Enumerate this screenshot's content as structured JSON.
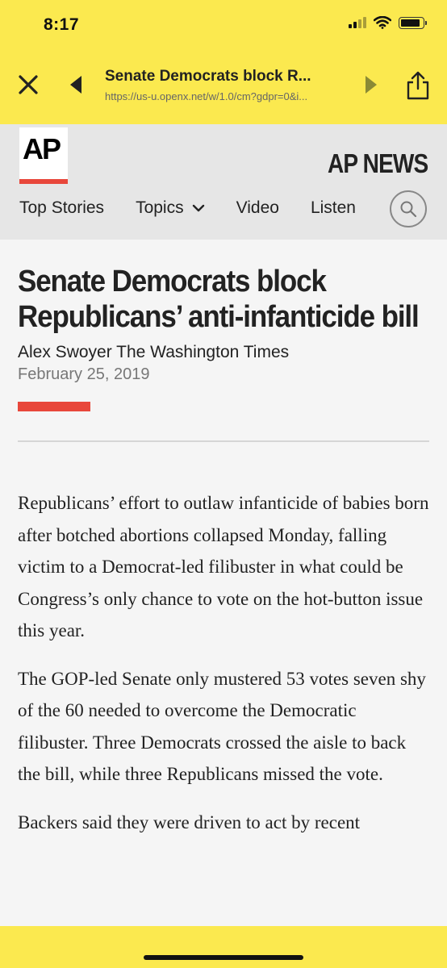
{
  "status": {
    "time": "8:17",
    "battery_level": 0.9
  },
  "browser": {
    "page_title": "Senate Democrats block R...",
    "url": "https://us-u.openx.net/w/1.0/cm?gdpr=0&i...",
    "icons": {
      "close": "close-icon",
      "back": "back-arrow-icon",
      "forward": "forward-arrow-icon",
      "share": "share-icon"
    }
  },
  "site": {
    "logo_text": "AP",
    "name": "AP NEWS",
    "accent_color": "#e8473b",
    "nav": {
      "top_stories": "Top Stories",
      "topics": "Topics",
      "video": "Video",
      "listen": "Listen"
    }
  },
  "article": {
    "headline": "Senate Democrats block Republicans’ anti-infanticide bill",
    "byline": "Alex Swoyer The Washington Times",
    "date": "February 25, 2019",
    "paragraphs": [
      "Republicans’ effort to outlaw infanticide of babies born after botched abortions collapsed Monday, falling victim to a Democrat-led filibuster in what could be Congress’s only chance to vote on the hot-button issue this year.",
      "The GOP-led Senate only mustered 53 votes seven shy of the 60 needed to overcome the Democratic filibuster. Three Democrats crossed the aisle to back the bill, while three Republicans missed the vote.",
      "Backers said they were driven to act by recent"
    ]
  },
  "colors": {
    "browser_chrome": "#fbe94f",
    "header_bg": "#e6e6e6",
    "page_bg": "#f5f5f5"
  }
}
